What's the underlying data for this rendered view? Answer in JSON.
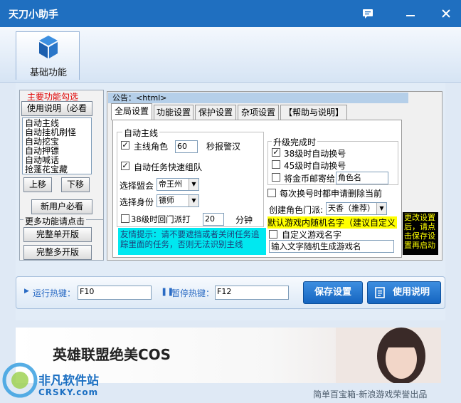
{
  "window": {
    "title": "天刀小助手"
  },
  "nav": {
    "tab_label": "基础功能"
  },
  "left": {
    "group_title": "主要功能勾选",
    "help_button": "使用说明（必看",
    "list_items": [
      "自动主线",
      "自动挂机刷怪",
      "自动挖宝",
      "自动押镖",
      "自动喊话",
      "抢蓬花宝藏"
    ],
    "up_button": "上移",
    "down_button": "下移",
    "new_user_button": "新用户必看",
    "more_group_title": "更多功能请点击",
    "single_button": "完整单开版",
    "multi_button": "完整多开版"
  },
  "notice": {
    "label": "公告：<html>"
  },
  "tabs": [
    "全局设置",
    "功能设置",
    "保护设置",
    "杂项设置",
    "【帮助与说明】"
  ],
  "mainline": {
    "group_title": "自动主线",
    "role_label": "主线角色",
    "role_value": "60",
    "role_suffix": "秒报警汉",
    "quick_team_label": "自动任务快速组队",
    "alliance_label": "选择盟会",
    "alliance_value": "帝王州",
    "identity_label": "选择身份",
    "identity_value": "镖师",
    "return_label": "38级时回门派打",
    "return_value": "20",
    "return_suffix": "分钟",
    "hint": "友情提示：请不要遮挡或者关闭任务追踪里面的任务，否则无法识别主线"
  },
  "upgrade": {
    "group_title": "升级完成时",
    "opt38": "38级时自动换号",
    "opt45": "45级时自动换号",
    "mail_label": "将金币邮寄给",
    "mail_placeholder": "角色名",
    "apply_delete_label": "每次换号时都申请删除当前",
    "create_label": "创建角色门派:",
    "create_value": "天香（推荐）",
    "random_name_notice": "默认游戏内随机名字（建议自定义",
    "custom_name_label": "自定义游戏名字",
    "custom_name_value": "输入文字随机生成游戏名"
  },
  "side_note": "更改设置后，请点击保存设置再启动",
  "hotkeys": {
    "run_label": "运行热键：",
    "run_value": "F10",
    "pause_label": "暂停热键：",
    "pause_value": "F12",
    "save_button": "保存设置",
    "help_button": "使用说明"
  },
  "banner": {
    "text": "英雄联盟绝美COS"
  },
  "footer": {
    "text": "简单百宝箱-新浪游戏荣誉出品"
  },
  "watermark": {
    "line1": "非凡软件站",
    "line2": "CRSKY.com"
  },
  "colors": {
    "titlebar": "#1f6fc0",
    "accent_button": "#1565c0",
    "hint_bg": "#00e8f0",
    "notice_yellow": "#ffff00"
  }
}
